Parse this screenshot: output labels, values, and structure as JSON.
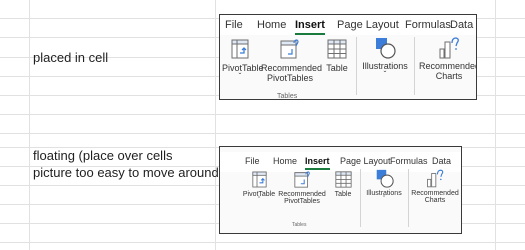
{
  "cells": {
    "placed_label": "placed in cell",
    "floating_line1": "floating (place over cells",
    "floating_line2": "picture too easy to move around"
  },
  "ribbon": {
    "tabs": [
      "File",
      "Home",
      "Insert",
      "Page Layout",
      "Formulas",
      "Data"
    ],
    "active_tab": "Insert",
    "commands": {
      "pivottable": "PivotTable",
      "recommended_pivottables_1": "Recommended",
      "recommended_pivottables_2": "PivotTables",
      "table": "Table",
      "illustrations": "Illustrations",
      "recommended_charts_1": "Recommended",
      "recommended_charts_2": "Charts"
    },
    "group_label": "Tables",
    "dropdown_glyph": "ˇ"
  },
  "colors": {
    "accent": "#1b7a3e",
    "icon_blue": "#3b7dd8",
    "icon_gray": "#6e6e6e"
  }
}
